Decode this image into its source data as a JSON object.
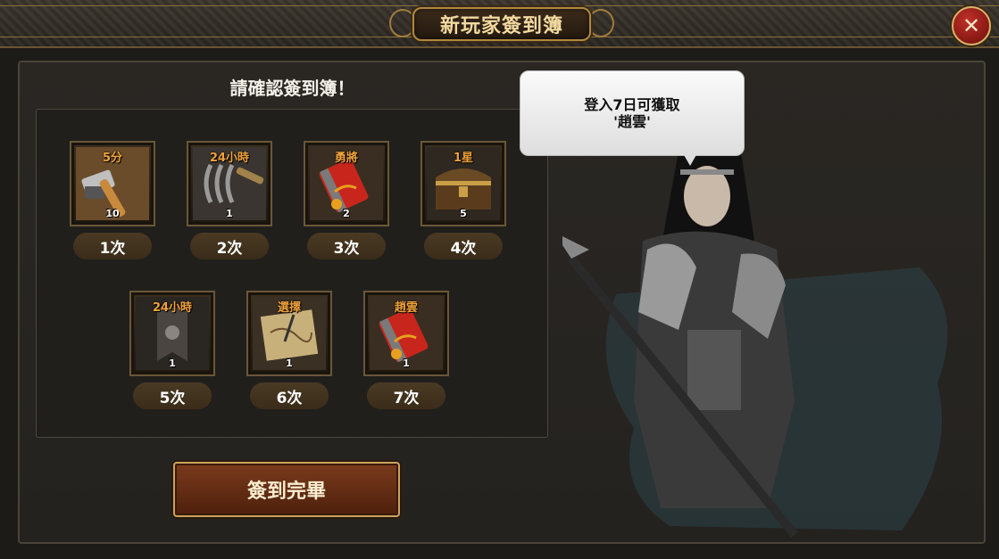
{
  "header": {
    "title": "新玩家簽到簿",
    "close_symbol": "✕"
  },
  "panel": {
    "heading": "請確認簽到簿！"
  },
  "rewards": [
    {
      "top_label": "5分",
      "count": "10",
      "day": "1次",
      "icon": "hammer-icon"
    },
    {
      "top_label": "24小時",
      "count": "1",
      "day": "2次",
      "icon": "rake-icon"
    },
    {
      "top_label": "勇將",
      "count": "2",
      "day": "3次",
      "icon": "scroll-icon"
    },
    {
      "top_label": "1星",
      "count": "5",
      "day": "4次",
      "icon": "treasure-chest-icon"
    },
    {
      "top_label": "24小時",
      "count": "1",
      "day": "5次",
      "icon": "banner-icon"
    },
    {
      "top_label": "選擇",
      "count": "1",
      "day": "6次",
      "icon": "map-icon"
    },
    {
      "top_label": "趙雲",
      "count": "1",
      "day": "7次",
      "icon": "scroll-icon"
    }
  ],
  "complete_button": {
    "label": "簽到完畢"
  },
  "speech_bubble": {
    "line1": "登入7日可獲取",
    "line2": "'趙雲'"
  },
  "colors": {
    "accent_gold": "#f0a23a",
    "close_red": "#c0302a",
    "button_brown": "#7a3a1c"
  }
}
